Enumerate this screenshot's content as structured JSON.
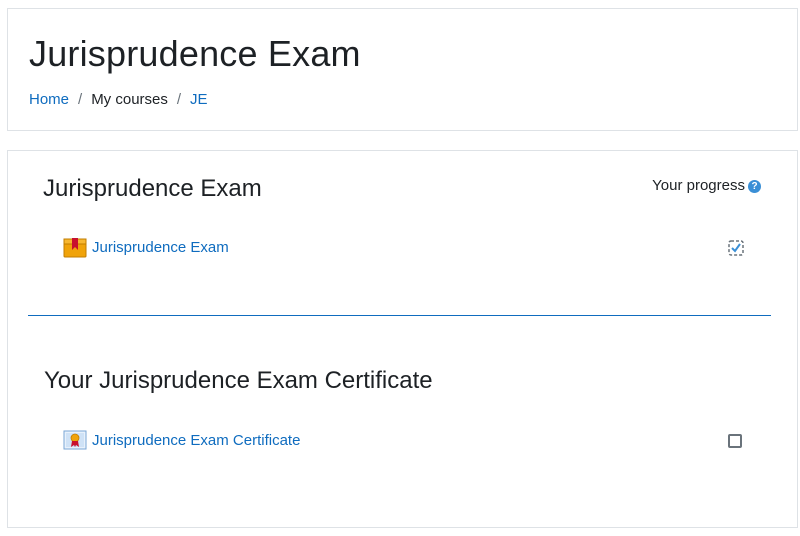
{
  "header": {
    "title": "Jurisprudence Exam",
    "breadcrumb": {
      "home": "Home",
      "my_courses": "My courses",
      "course": "JE",
      "separator": "/"
    }
  },
  "progress": {
    "label": "Your progress",
    "help_icon": "question-circle-icon",
    "help_glyph": "?"
  },
  "sections": [
    {
      "title": "Jurisprudence Exam",
      "activity": {
        "label": "Jurisprudence Exam",
        "icon": "quiz-icon",
        "completion": "checked-auto"
      }
    },
    {
      "title": "Your Jurisprudence Exam Certificate",
      "activity": {
        "label": "Jurisprudence Exam Certificate",
        "icon": "certificate-icon",
        "completion": "unchecked"
      }
    }
  ],
  "colors": {
    "link": "#0f6cbf",
    "divider": "#0f6cbf",
    "quiz_icon": "#f0a30a",
    "help_icon": "#3a8fd6"
  }
}
